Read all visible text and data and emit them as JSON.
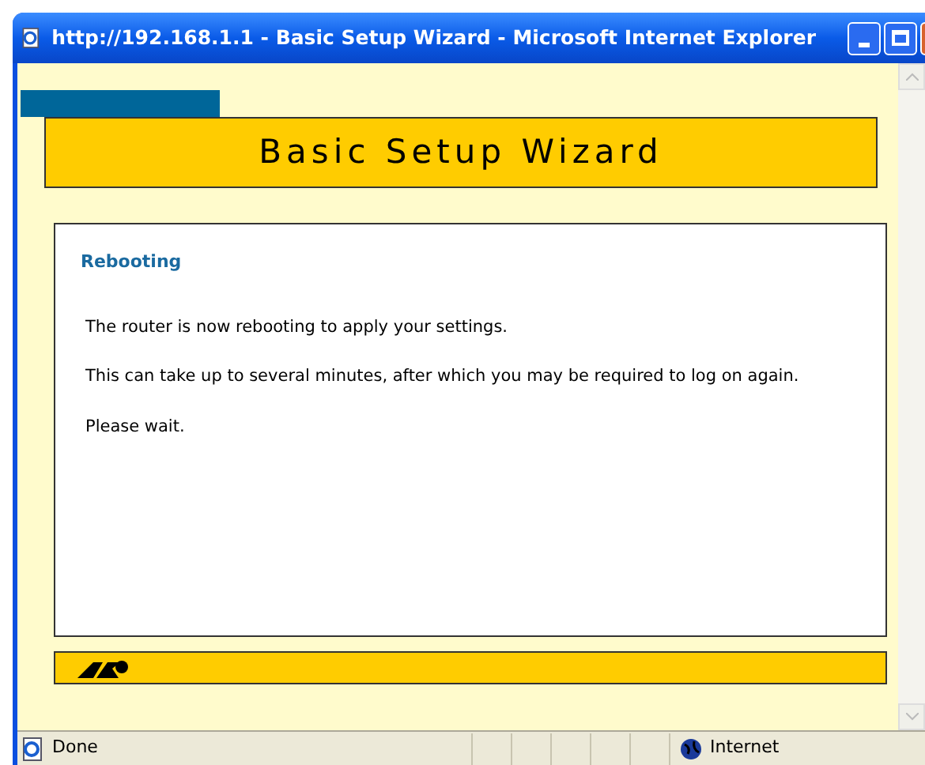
{
  "window": {
    "title": "http://192.168.1.1 - Basic Setup Wizard - Microsoft Internet Explorer"
  },
  "banner": {
    "title": "Basic Setup Wizard"
  },
  "panel": {
    "heading": "Rebooting",
    "paragraphs": [
      "The router is now rebooting to apply your settings.",
      "This can take up to several minutes, after which you may be required to log on again.",
      "Please wait."
    ]
  },
  "status_bar": {
    "text": "Done",
    "zone": "Internet"
  }
}
